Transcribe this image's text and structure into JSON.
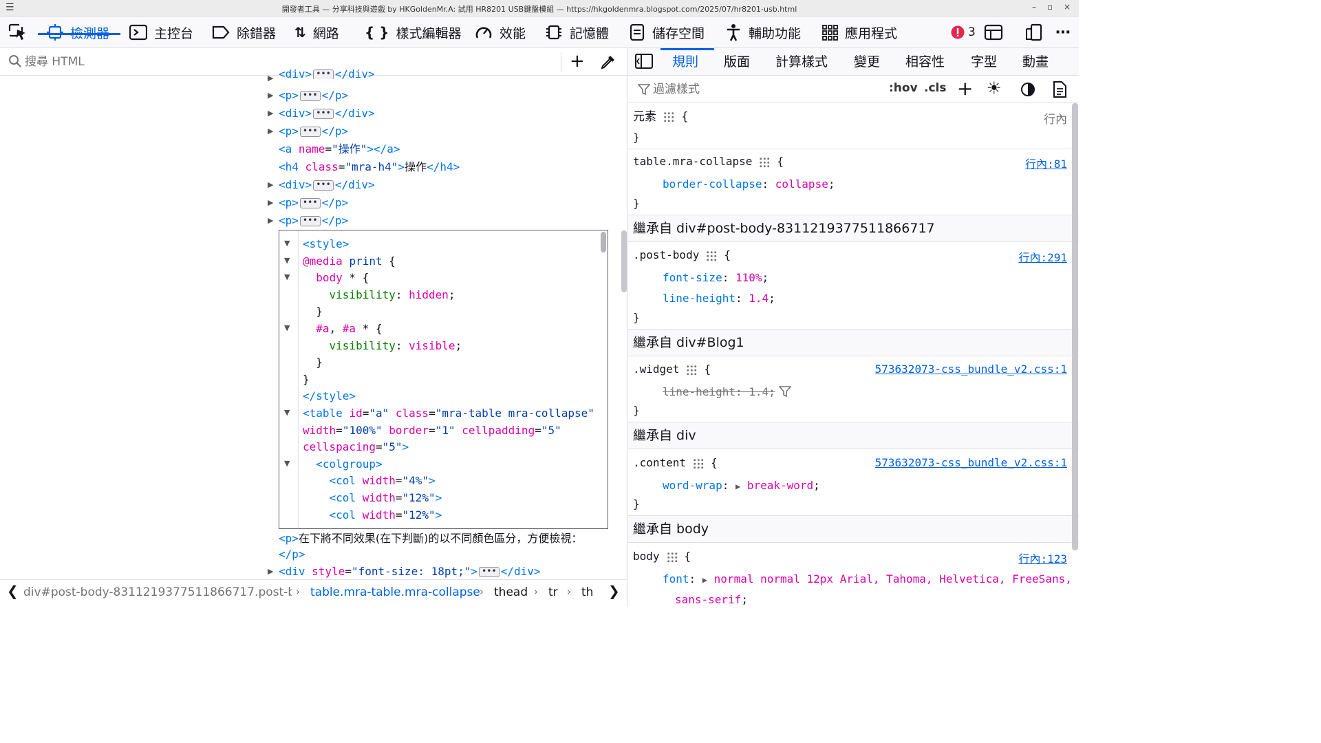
{
  "window": {
    "title": "開發者工具 — 分享科技與遊戲 by HKGoldenMr.A: 試用 HR8201 USB鍵盤模組 — https://hkgoldenmra.blogspot.com/2025/07/hr8201-usb.html",
    "menu_icon": "hamburger-icon",
    "minimize": "–",
    "restore": "▫",
    "close": "×"
  },
  "toolbar": {
    "tabs": [
      {
        "label": "檢測器",
        "icon": "inspector-icon"
      },
      {
        "label": "主控台",
        "icon": "console-icon"
      },
      {
        "label": "除錯器",
        "icon": "debugger-icon"
      },
      {
        "label": "網路",
        "icon": "network-icon"
      },
      {
        "label": "樣式編輯器",
        "icon": "style-editor-icon"
      },
      {
        "label": "效能",
        "icon": "performance-icon"
      },
      {
        "label": "記憶體",
        "icon": "memory-icon"
      },
      {
        "label": "儲存空間",
        "icon": "storage-icon"
      },
      {
        "label": "輔助功能",
        "icon": "accessibility-icon"
      },
      {
        "label": "應用程式",
        "icon": "application-icon"
      }
    ],
    "error_count": "3",
    "accent": "#0061e0"
  },
  "inspector": {
    "search_placeholder": "搜尋 HTML",
    "lines": [
      {
        "open": "<",
        "tag": "div",
        "close": ">",
        "end": "</div>"
      },
      {
        "tag": "p",
        "end": "</p>"
      },
      {
        "tag": "div",
        "end": "</div>"
      },
      {
        "tag": "p",
        "end": "</p>"
      }
    ],
    "anchor_line": {
      "tag_open": "<a",
      "attr": "name",
      "eq": "=",
      "val": "\"操作\"",
      "close": "></a>"
    },
    "h4_line": {
      "tag_open": "<h4",
      "attr": "class",
      "eq": "=",
      "val": "\"mra-h4\"",
      "gt": ">",
      "text": "操作",
      "end": "</h4>"
    },
    "lines2": [
      {
        "tag": "div",
        "end": "</div>"
      },
      {
        "tag": "p",
        "end": "</p>"
      },
      {
        "tag": "p",
        "end": "</p>"
      }
    ],
    "style_block": [
      "<style>",
      "@media print {",
      "  body * {",
      "    visibility: hidden;",
      "  }",
      "  #a, #a * {",
      "    visibility: visible;",
      "  }",
      "}",
      "</style>",
      "<table id=\"a\" class=\"mra-table mra-collapse\"",
      "width=\"100%\" border=\"1\" cellpadding=\"5\"",
      "cellspacing=\"5\">",
      "  <colgroup>",
      "    <col width=\"4%\">",
      "    <col width=\"12%\">",
      "    <col width=\"12%\">"
    ],
    "after_p_text": "在下將不同效果(在下判斷)的以不同顏色區分，方便檢視：",
    "after_p_end": "</p>",
    "last_line": {
      "attr": "style",
      "val": "\"font-size: 18pt;\""
    },
    "breadcrumb": [
      "div#post-body-8311219377511866717.post-b...",
      "table.mra-table.mra-collapse",
      "thead",
      "tr",
      "th"
    ]
  },
  "rules": {
    "tabs": [
      "規則",
      "版面",
      "計算樣式",
      "變更",
      "相容性",
      "字型",
      "動畫"
    ],
    "filter_placeholder": "過濾樣式",
    "hov": ":hov",
    "cls": ".cls",
    "element_rule": {
      "selector": "元素",
      "source": "行內"
    },
    "table_rule": {
      "selector": "table.mra-collapse",
      "source": "行內:81",
      "prop": "border-collapse",
      "value": "collapse"
    },
    "inherit1": "繼承自 div#post-body-8311219377511866717",
    "postbody_rule": {
      "selector": ".post-body",
      "source": "行內:291",
      "props": [
        {
          "name": "font-size",
          "value": "110%"
        },
        {
          "name": "line-height",
          "value": "1.4"
        }
      ]
    },
    "inherit2": "繼承自 div#Blog1",
    "widget_rule": {
      "selector": ".widget",
      "source": "573632073-css_bundle_v2.css:1",
      "prop": "line-height: 1.4;"
    },
    "inherit3": "繼承自 div",
    "content_rule": {
      "selector": ".content",
      "source": "573632073-css_bundle_v2.css:1",
      "prop": "word-wrap",
      "value": "break-word"
    },
    "inherit4": "繼承自 body",
    "body_rule": {
      "selector": "body",
      "source": "行內:123",
      "prop": "font",
      "value": "normal normal 12px Arial, Tahoma, Helvetica, FreeSans,",
      "value2": "sans-serif"
    }
  }
}
